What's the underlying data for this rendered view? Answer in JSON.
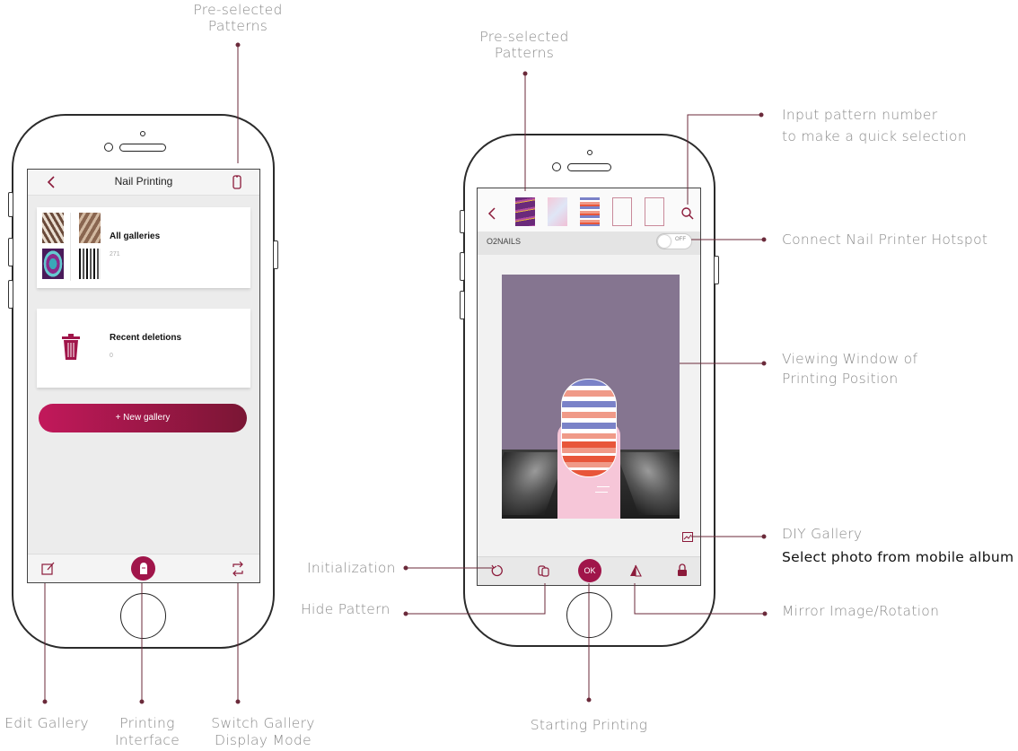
{
  "annotations": {
    "left_top": "Pre-selected Patterns",
    "left_edit": "Edit Gallery",
    "left_printing": "Printing Interface",
    "left_switch": "Switch Gallery Display Mode",
    "right_top": "Pre-selected Patterns",
    "input_pattern_1": "Input pattern number",
    "input_pattern_2": "to make a quick selection",
    "hotspot": "Connect Nail Printer Hotspot",
    "viewing_1": "Viewing Window of",
    "viewing_2": "Printing Position",
    "diy": "DIY Gallery",
    "select_photo": "Select photo from mobile album",
    "initialization": "Initialization",
    "hide_pattern": "Hide Pattern",
    "mirror": "Mirror Image/Rotation",
    "starting": "Starting Printing"
  },
  "left_screen": {
    "title": "Nail Printing",
    "all_galleries": {
      "label": "All galleries",
      "count": "271"
    },
    "recent_deletions": {
      "label": "Recent deletions",
      "count": "0"
    },
    "new_gallery_button": "+ New gallery",
    "icons": [
      "back-chevron-icon",
      "phone-icon",
      "edit-icon",
      "nail-print-icon",
      "switch-icon",
      "trash-icon"
    ]
  },
  "right_screen": {
    "device_name": "O2NAILS",
    "toggle_label": "OFF",
    "ok_button": "OK",
    "icons": [
      "back-chevron-icon",
      "search-icon",
      "diy-gallery-icon",
      "reset-icon",
      "hide-pattern-icon",
      "mirror-icon",
      "lock-icon"
    ]
  },
  "colors": {
    "accent": "#c2185b",
    "accent_dark": "#8b1a3a",
    "leader_line": "#6b2a3a",
    "preview_bg": "#857590",
    "stripe_blue": "#7a82c8",
    "stripe_salmon": "#f09a88",
    "stripe_red": "#e8563a",
    "finger_pink": "#f6c6d8"
  }
}
